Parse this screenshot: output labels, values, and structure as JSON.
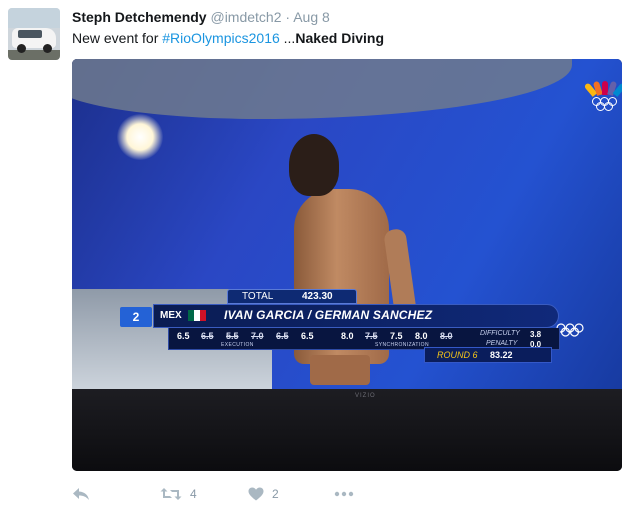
{
  "tweet": {
    "display_name": "Steph Detchemendy",
    "handle": "@imdetch2",
    "separator": "·",
    "timestamp": "Aug 8",
    "text_prefix": "New event for ",
    "hashtag": "#RioOlympics2016",
    "text_suffix": " ...",
    "text_bold": "Naked Diving",
    "retweet_count": "4",
    "like_count": "2"
  },
  "colors": {
    "link_blue": "#1b95e0",
    "muted_gray": "#8899a6",
    "broadcast_blue": "#0e2a73",
    "round_gold": "#f5c518"
  },
  "icons": [
    "reply-icon",
    "retweet-icon",
    "heart-icon",
    "more-icon",
    "nbc-peacock-icon",
    "olympic-rings-icon"
  ],
  "broadcast": {
    "total_label": "TOTAL",
    "total_value": "423.30",
    "rank": "2",
    "country": "MEX",
    "athletes": "IVAN GARCIA / GERMAN SANCHEZ",
    "execution_scores": [
      "6.5",
      "6.5",
      "5.5",
      "7.0",
      "6.5",
      "6.5"
    ],
    "execution_caption": "EXECUTION",
    "synchronization_scores": [
      "8.0",
      "7.5",
      "7.5",
      "8.0",
      "8.0"
    ],
    "synchronization_caption": "SYNCHRONIZATION",
    "difficulty_label": "DIFFICULTY",
    "difficulty_value": "3.8",
    "penalty_label": "PENALTY",
    "penalty_value": "0.0",
    "round_label": "ROUND 6",
    "round_score": "83.22",
    "tv_brand": "VIZIO"
  }
}
